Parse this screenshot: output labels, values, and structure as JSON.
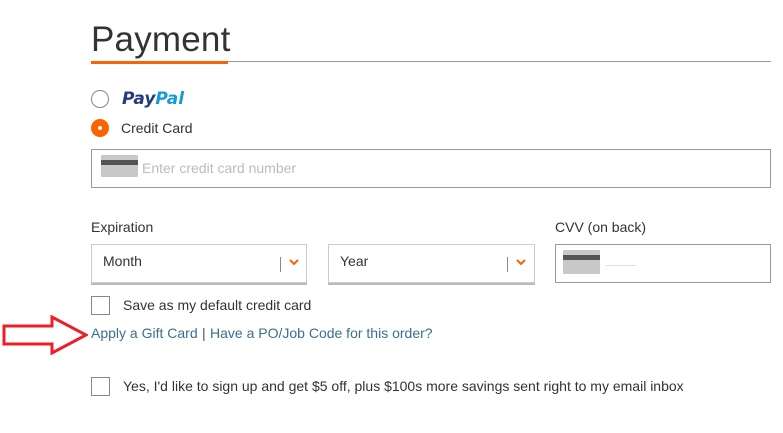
{
  "page": {
    "title": "Payment"
  },
  "payment_methods": {
    "paypal": {
      "logo_pay": "Pay",
      "logo_pal": "Pal",
      "selected": false
    },
    "credit_card": {
      "label": "Credit Card",
      "selected": true
    }
  },
  "card_number": {
    "placeholder": "Enter credit card number",
    "value": ""
  },
  "expiration": {
    "label": "Expiration",
    "month": {
      "selected": "Month"
    },
    "year": {
      "selected": "Year"
    }
  },
  "cvv": {
    "label": "CVV (on back)",
    "value": ""
  },
  "options": {
    "save_default_label": "Save as my default credit card",
    "save_default_checked": false,
    "gift_card_link": "Apply a Gift Card",
    "link_separator": "|",
    "po_code_link": "Have a PO/Job Code for this order?",
    "signup_label": "Yes, I'd like to sign up and get $5 off, plus $100s more savings sent right to my email inbox",
    "signup_checked": false
  },
  "colors": {
    "accent": "#f96302",
    "link": "#3a6f8f",
    "annotation_arrow": "#e8202a"
  },
  "annotations": {
    "arrow_icon": "red-right-arrow-icon"
  }
}
